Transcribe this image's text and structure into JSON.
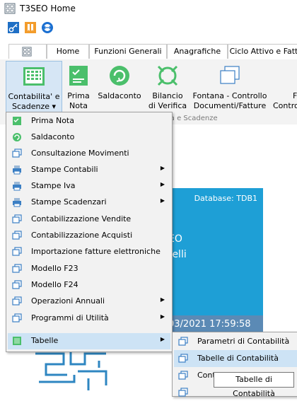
{
  "window": {
    "title": "T3SEO Home"
  },
  "quickbar": {
    "icons": [
      "key-icon",
      "orange-bookmark-icon",
      "teamviewer-icon"
    ]
  },
  "tabs": [
    {
      "label": ""
    },
    {
      "label": "Home"
    },
    {
      "label": "Funzioni Generali"
    },
    {
      "label": "Anagrafiche"
    },
    {
      "label": "Ciclo Attivo e Fatt"
    }
  ],
  "ribbon": {
    "buttons": [
      {
        "label1": "Contabilita' e",
        "label2": "Scadenze ▾"
      },
      {
        "label1": "Prima",
        "label2": "Nota"
      },
      {
        "label1": "Saldaconto",
        "label2": ""
      },
      {
        "label1": "Bilancio",
        "label2": "di Verifica"
      },
      {
        "label1": "Fontana - Controllo",
        "label2": "Documenti/Fatture"
      },
      {
        "label1": "F",
        "label2": "Contro"
      }
    ],
    "group_label": "ia e Scadenze"
  },
  "background": {
    "database": "Database: TDB1",
    "text1": "EO",
    "text2": "relli",
    "datetime": "03/2021 17:59:58"
  },
  "menu": {
    "items": [
      {
        "label": "Prima Nota",
        "icon": "prima-nota-icon",
        "submenu": false
      },
      {
        "label": "Saldaconto",
        "icon": "saldaconto-icon",
        "submenu": false
      },
      {
        "label": "Consultazione Movimenti",
        "icon": "window-icon",
        "submenu": false
      },
      {
        "label": "Stampe Contabili",
        "icon": "printer-icon",
        "submenu": true
      },
      {
        "label": "Stampe Iva",
        "icon": "printer-icon",
        "submenu": true
      },
      {
        "label": "Stampe Scadenzari",
        "icon": "printer-icon",
        "submenu": true
      },
      {
        "label": "Contabilizzazione Vendite",
        "icon": "window-icon",
        "submenu": false
      },
      {
        "label": "Contabilizzazione Acquisti",
        "icon": "window-icon",
        "submenu": false
      },
      {
        "label": "Importazione fatture elettroniche",
        "icon": "window-icon",
        "submenu": false
      },
      {
        "label": "Modello F23",
        "icon": "window-icon",
        "submenu": false
      },
      {
        "label": "Modello F24",
        "icon": "window-icon",
        "submenu": false
      },
      {
        "label": "Operazioni Annuali",
        "icon": "window-icon",
        "submenu": true
      },
      {
        "label": "Programmi di Utilità",
        "icon": "window-icon",
        "submenu": true
      },
      {
        "label": "Tabelle",
        "icon": "table-icon",
        "submenu": true
      }
    ]
  },
  "submenu": {
    "items": [
      {
        "label": "Parametri di Contabilità"
      },
      {
        "label": "Tabelle di Contabilità"
      },
      {
        "label": "Cont"
      },
      {
        "label": ""
      }
    ]
  },
  "tooltip": {
    "text": "Tabelle di Contabilità"
  },
  "colors": {
    "accent": "#1e9fd6",
    "green": "#4bbf6b",
    "selection": "#cde3f5"
  }
}
